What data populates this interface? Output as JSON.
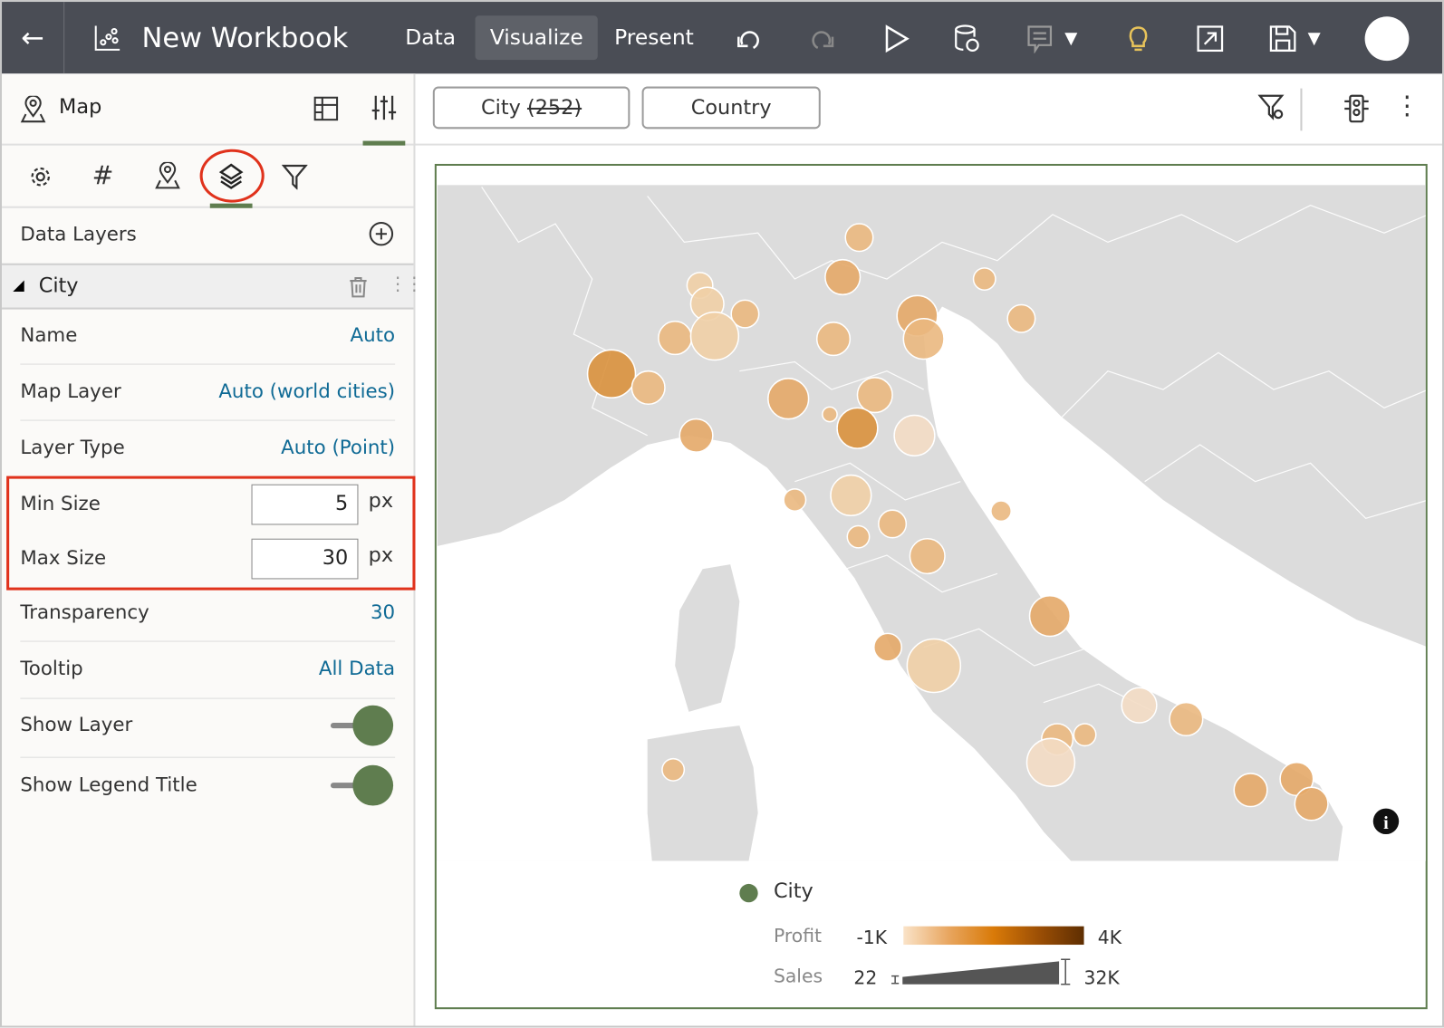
{
  "header": {
    "title": "New Workbook",
    "nav": [
      "Data",
      "Visualize",
      "Present"
    ],
    "active_nav": "Visualize"
  },
  "left_panel": {
    "viz_type": "Map",
    "section_title": "Data Layers",
    "layer_name": "City",
    "properties": [
      {
        "label": "Name",
        "value": "Auto"
      },
      {
        "label": "Map Layer",
        "value": "Auto (world cities)"
      },
      {
        "label": "Layer Type",
        "value": "Auto (Point)"
      },
      {
        "label": "Min Size",
        "value": "5",
        "unit": "px"
      },
      {
        "label": "Max Size",
        "value": "30",
        "unit": "px"
      },
      {
        "label": "Transparency",
        "value": "30"
      },
      {
        "label": "Tooltip",
        "value": "All Data"
      },
      {
        "label": "Show Layer",
        "value": true
      },
      {
        "label": "Show Legend Title",
        "value": true
      }
    ]
  },
  "canvas": {
    "pills": [
      {
        "label": "City",
        "count": "(252)"
      },
      {
        "label": "Country"
      }
    ]
  },
  "legend": {
    "title": "City",
    "profit_label": "Profit",
    "profit_min": "-1K",
    "profit_max": "4K",
    "sales_label": "Sales",
    "sales_min": "22",
    "sales_max": "32K"
  },
  "colors": {
    "accent": "#5f7d4f",
    "header": "#4a4d55",
    "highlight": "#e0321c",
    "link": "#0f6a95"
  }
}
